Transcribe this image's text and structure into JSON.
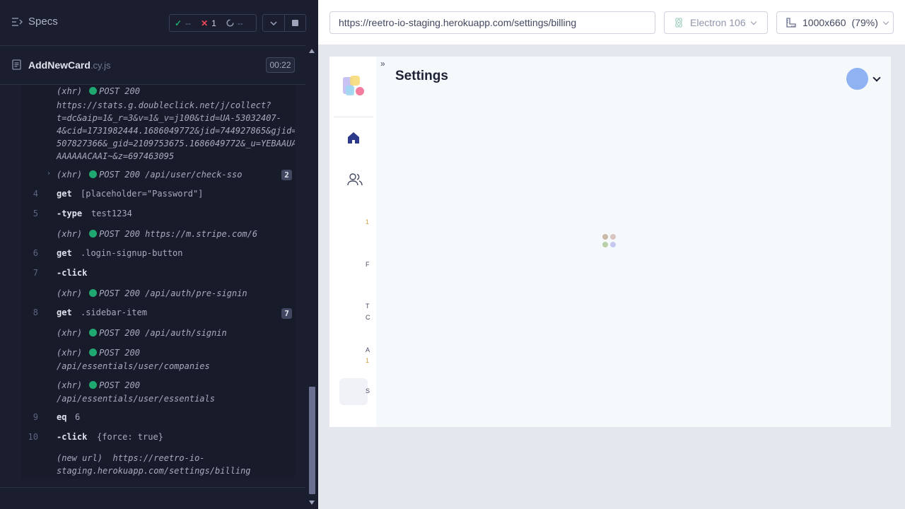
{
  "reporter": {
    "specs_label": "Specs",
    "stats": {
      "passed": "--",
      "failed": "1",
      "pending": "--"
    },
    "spec_file": {
      "name": "AddNewCard",
      "ext": ".cy.js",
      "duration": "00:22"
    },
    "commands": [
      {
        "kind": "xhr",
        "prefix": "(xhr)",
        "status": "POST 200",
        "url_lines": [
          "https://stats.g.doubleclick.net/j/collect?",
          "t=dc&aip=1&_r=3&v=1&_v=j100&tid=UA-53032407-",
          "4&cid=1731982444.1686049772&jid=744927865&gjid=",
          "507827366&_gid=2109753675.1686049772&_u=YEBAAUA",
          "AAAAAACAAI~&z=697463095"
        ]
      },
      {
        "kind": "xhr",
        "prefix": "(xhr)",
        "status": "POST 200",
        "url": "/api/user/check-sso",
        "badge": "2"
      },
      {
        "kind": "cmd",
        "line": "4",
        "name": "get",
        "arg": "[placeholder=\"Password\"]"
      },
      {
        "kind": "cmd",
        "line": "5",
        "name": "-type",
        "arg": "test1234"
      },
      {
        "kind": "xhr",
        "prefix": "(xhr)",
        "status": "POST 200",
        "url": "https://m.stripe.com/6"
      },
      {
        "kind": "cmd",
        "line": "6",
        "name": "get",
        "arg": ".login-signup-button"
      },
      {
        "kind": "cmd",
        "line": "7",
        "name": "-click",
        "arg": ""
      },
      {
        "kind": "xhr",
        "prefix": "(xhr)",
        "status": "POST 200",
        "url": "/api/auth/pre-signin"
      },
      {
        "kind": "cmd",
        "line": "8",
        "name": "get",
        "arg": ".sidebar-item",
        "badge": "7"
      },
      {
        "kind": "xhr",
        "prefix": "(xhr)",
        "status": "POST 200",
        "url": "/api/auth/signin"
      },
      {
        "kind": "xhr",
        "prefix": "(xhr)",
        "status": "POST 200",
        "url": "/api/essentials/user/companies"
      },
      {
        "kind": "xhr",
        "prefix": "(xhr)",
        "status": "POST 200",
        "url": "/api/essentials/user/essentials"
      },
      {
        "kind": "cmd",
        "line": "9",
        "name": "eq",
        "arg": "6"
      },
      {
        "kind": "cmd",
        "line": "10",
        "name": "-click",
        "arg": "{force: true}"
      },
      {
        "kind": "newurl",
        "prefix": "(new url)",
        "url_lines": [
          "https://reetro-io-",
          "staging.herokuapp.com/settings/billing"
        ]
      }
    ]
  },
  "aut": {
    "url": "https://reetro-io-staging.herokuapp.com/settings/billing",
    "browser": "Electron 106",
    "viewport": "1000x660",
    "zoom": "(79%)"
  },
  "app": {
    "page_title": "Settings",
    "colors": {
      "accent": "#2d3a8c",
      "avatar": "#8eb2f2",
      "status_ok": "#1fa971",
      "status_fail": "#f0475b"
    }
  }
}
